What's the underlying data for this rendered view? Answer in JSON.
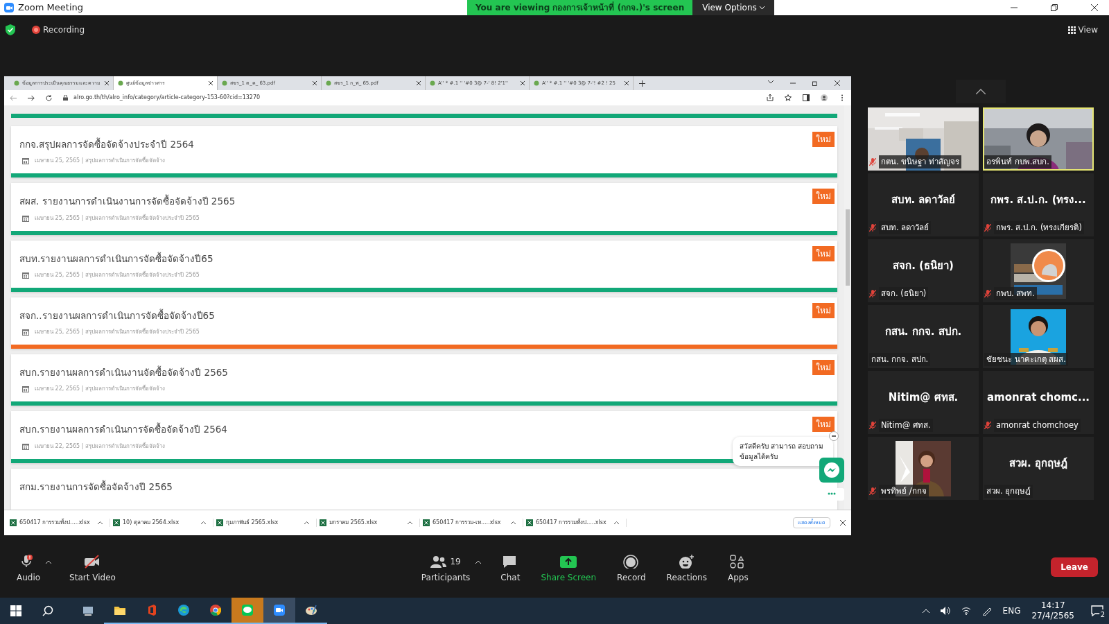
{
  "window": {
    "title": "Zoom Meeting",
    "banner": "You are viewing **กองการเจ้าหน้าที่ (กกจ.)**'s screen",
    "view_options": "View Options",
    "recording": "Recording",
    "view": "View"
  },
  "browser": {
    "tabs": [
      {
        "label": "ข้อมูลการประเมินคุณธรรมและความ",
        "selected": false
      },
      {
        "label": "ศูนย์ข้อมูลข่าวสาร",
        "selected": true
      },
      {
        "label": "สขร_1 ต_ค_ 63.pdf",
        "selected": false
      },
      {
        "label": "สขร_1 ก_พ_ 65.pdf",
        "selected": false
      },
      {
        "label": "A'' * #.1 '' '#0 3@ 7-' 8! 2'1''",
        "selected": false
      },
      {
        "label": "A'' * #.1 '' '#0 3@ 7-'! #2 ! 25",
        "selected": false
      }
    ],
    "url": "alro.go.th/th/alro_info/category/article-category-153-60?cid=13270",
    "cards": [
      {
        "title": "กกจ.สรุปผลการจัดซื้อจัดจ้างประจำปี 2564",
        "meta": "เมษายน 25, 2565 | สรุปผลการดำเนินการจัดซื้อจัดจ้าง",
        "badge": "ใหม่",
        "color": "#12a878"
      },
      {
        "title": "สผส. รายงานการดำเนินงานการจัดซื้อจัดจ้างปี 2565",
        "meta": "เมษายน 25, 2565 | สรุปผลการดำเนินการจัดซื้อจัดจ้างประจำปี 2565",
        "badge": "ใหม่",
        "color": "#12a878"
      },
      {
        "title": "สบท.รายงานผลการดำเนินการจัดซื้อจัดจ้างปี65",
        "meta": "เมษายน 25, 2565 | สรุปผลการดำเนินการจัดซื้อจัดจ้างประจำปี 2565",
        "badge": "ใหม่",
        "color": "#12a878"
      },
      {
        "title": "สจก..รายงานผลการดำเนินการจัดซื้อจัดจ้างปี65",
        "meta": "เมษายน 25, 2565 | สรุปผลการดำเนินการจัดซื้อจัดจ้างประจำปี 2565",
        "badge": "ใหม่",
        "color": "#f26a22"
      },
      {
        "title": "สบก.รายงานผลการดำเนินงานจัดซื้อจัดจ้างปี 2565",
        "meta": "เมษายน 22, 2565 | สรุปผลการดำเนินการจัดซื้อจัดจ้าง",
        "badge": "ใหม่",
        "color": "#12a878"
      },
      {
        "title": "สบก.รายงานผลการดำเนินการจัดซื้อจัดจ้างปี 2564",
        "meta": "เมษายน 22, 2565 | สรุปผลการดำเนินการจัดซื้อจัดจ้าง",
        "badge": "ใหม่",
        "color": "#12a878"
      },
      {
        "title": "สกม.รายงานการจัดซื้อจัดจ้างปี 2565"
      }
    ],
    "chat_popup": "สวัสดีครับ สามารถ สอบถามข้อมูลได้ครับ",
    "downloads": [
      "650417 การรวมทั้งป.....xlsx",
      "10) ตุลาคม 2564.xlsx",
      "กุมภาพันธ์ 2565.xlsx",
      "มกราคม 2565.xlsx",
      "650417 การรวม-เท.....xlsx",
      "650417 การรวมทั้งป.....xlsx"
    ],
    "show_all": "แสดงทั้งหมด"
  },
  "participants": [
    {
      "kind": "video",
      "label": "กตน. ขนิษฐา ท่าสัญจร",
      "muted": true,
      "speaking": false
    },
    {
      "kind": "video",
      "label": "อรพินท์ กบพ.สบก.",
      "muted": false,
      "speaking": true
    },
    {
      "kind": "name",
      "display": "สบท. ลดาวัลย์",
      "label": "สบท. ลดาวัลย์",
      "muted": true,
      "speaking": false
    },
    {
      "kind": "name",
      "display": "กพร. ส.ป.ก. (ทรง...",
      "label": "กพร. ส.ป.ก. (ทรงเกียรติ)",
      "muted": true,
      "speaking": false
    },
    {
      "kind": "name",
      "display": "สจก. (ธนิยา)",
      "label": "สจก. (ธนิยา)",
      "muted": true,
      "speaking": false
    },
    {
      "label": "กพบ. สพท.",
      "muted": true,
      "speaking": false
    },
    {
      "kind": "name",
      "display": "กสน. กกจ. สปก.",
      "label": "กสน. กกจ. สปก.",
      "muted": false,
      "speaking": false
    },
    {
      "label": "ชัยชนะ นาคะเกตุ สผส.",
      "muted": false,
      "speaking": false
    },
    {
      "kind": "name",
      "display": "Nitim@ ศทส.",
      "label": "Nitim@ ศทส.",
      "muted": true,
      "speaking": false
    },
    {
      "kind": "name",
      "display": "amonrat  chomc...",
      "label": "amonrat chomchoey",
      "muted": true,
      "speaking": false
    },
    {
      "label": "พรทิพย์ /กกจ",
      "muted": true,
      "speaking": false
    },
    {
      "kind": "name",
      "display": "สวผ.  อุกฤษฎ์",
      "label": "สวผ.  อุกฤษฎ์",
      "muted": false,
      "speaking": false
    }
  ],
  "toolbar": [
    {
      "kind": "audio",
      "label": "Audio"
    },
    {
      "kind": "video",
      "label": "Start Video"
    },
    {
      "kind": "participants",
      "label": "Participants",
      "count": "19"
    },
    {
      "kind": "chat",
      "label": "Chat"
    },
    {
      "kind": "share",
      "label": "Share Screen"
    },
    {
      "kind": "record",
      "label": "Record"
    },
    {
      "kind": "reactions",
      "label": "Reactions"
    },
    {
      "kind": "apps",
      "label": "Apps"
    }
  ],
  "leave": "Leave",
  "taskbar": {
    "language": "ENG",
    "time": "14:17",
    "date": "27/4/2565",
    "notifications": "2"
  }
}
